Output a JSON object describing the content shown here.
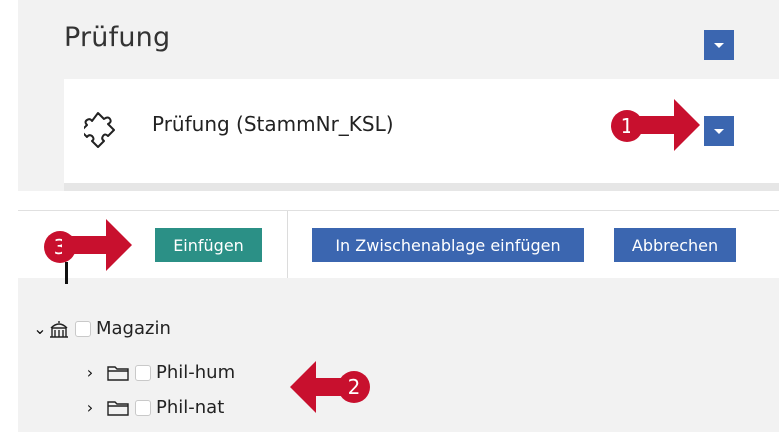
{
  "panel": {
    "title": "Prüfung",
    "item_label": "Prüfung (StammNr_KSL)"
  },
  "callouts": [
    "1",
    "2",
    "3"
  ],
  "toolbar": {
    "insert_label": "Einfügen",
    "clipboard_label": "In Zwischenablage einfügen",
    "cancel_label": "Abbrechen"
  },
  "tree": {
    "root": {
      "label": "Magazin",
      "icon": "building-icon"
    },
    "children": [
      {
        "label": "Phil-hum",
        "icon": "folder-icon"
      },
      {
        "label": "Phil-nat",
        "icon": "folder-icon"
      }
    ]
  },
  "colors": {
    "accent_blue": "#3b66b0",
    "accent_green": "#2b9086",
    "callout_red": "#c8102e",
    "panel_bg": "#f2f2f2"
  }
}
